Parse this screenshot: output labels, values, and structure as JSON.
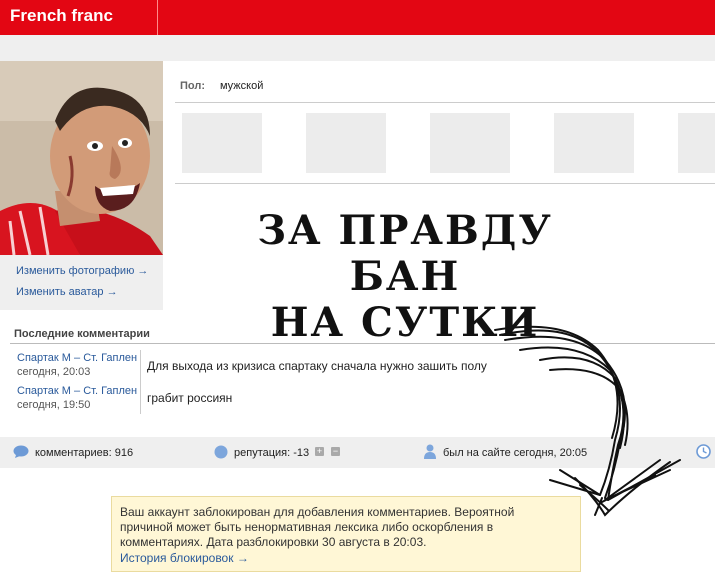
{
  "header": {
    "title": "French franc"
  },
  "profile": {
    "change_photo": "Изменить фотографию →",
    "change_avatar": "Изменить аватар →",
    "gender_label": "Пол:",
    "gender_value": "мужской"
  },
  "ban_caption": {
    "line1": "ЗА ПРАВДУ БАН",
    "line2": "НА СУТКИ"
  },
  "comments": {
    "heading": "Последние комментарии",
    "items": [
      {
        "topic": "Спартак М – Ст. Гаплен",
        "time": "сегодня, 20:03",
        "text": "Для выхода из кризиса спартаку сначала нужно зашить полу"
      },
      {
        "topic": "Спартак М – Ст. Гаплен",
        "time": "сегодня, 19:50",
        "text": "грабит россиян"
      }
    ]
  },
  "stats": {
    "comments": "комментариев: 916",
    "reputation": "репутация: -13",
    "last_seen": "был на сайте сегодня, 20:05"
  },
  "notice": {
    "text": "Ваш аккаунт заблокирован для добавления комментариев. Вероятной причиной может быть ненормативная лексика либо оскорбления в комментариях. Дата разблокировки 30 августа в 20:03.",
    "link": "История блокировок →"
  },
  "colors": {
    "brand": "#e30613",
    "link": "#2a5a9b",
    "notice_bg": "#fff7d6"
  }
}
